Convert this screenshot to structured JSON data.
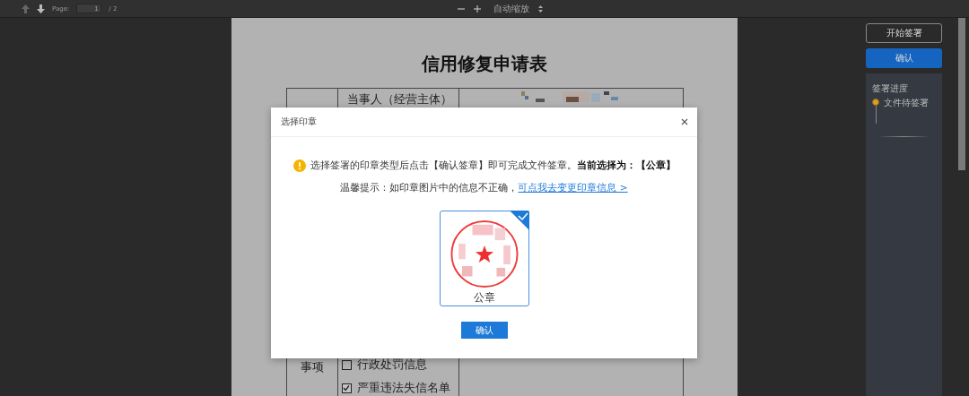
{
  "toolbar": {
    "page_label": "Page:",
    "page_value": "1",
    "page_total": "/ 2",
    "zoom_select": "自动缩放"
  },
  "document": {
    "title": "信用修复申请表",
    "party_label": "当事人（经营主体）",
    "matter_label": "事项",
    "options": [
      {
        "label": "行政处罚信息",
        "checked": false
      },
      {
        "label": "严重违法失信名单",
        "checked": true
      }
    ]
  },
  "side_panel": {
    "start_button": "开始签署",
    "confirm_button": "确认",
    "progress_title": "签署进度",
    "steps": [
      {
        "label": "文件待签署",
        "active": true
      }
    ]
  },
  "dialog": {
    "title": "选择印章",
    "message": "选择签署的印章类型后点击【确认签章】即可完成文件签章。**当前选择为：【公章】**",
    "tip": "温馨提示：如印章图片中的信息不正确，",
    "tip_link": "可点我去变更印章信息 >",
    "seals": [
      {
        "label": "公章",
        "selected": true
      }
    ],
    "confirm_button": "确认"
  }
}
